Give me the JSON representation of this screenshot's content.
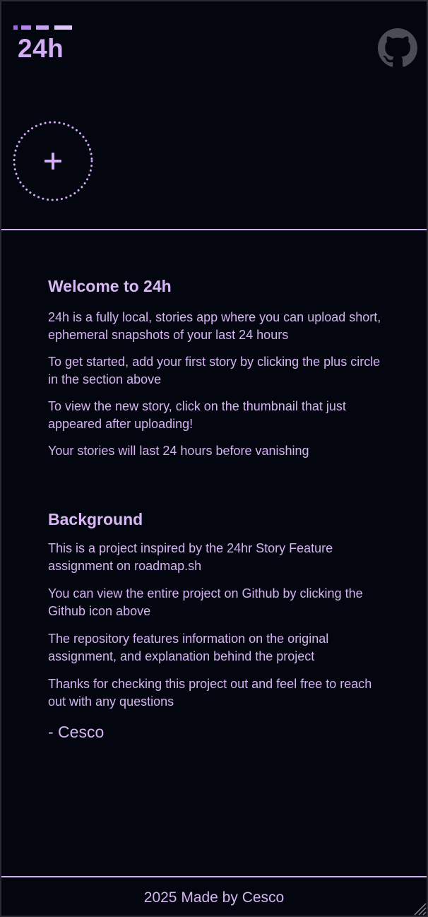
{
  "app": {
    "logo_text": "24h"
  },
  "header": {
    "github_icon": "github-icon",
    "add_story_icon": "plus-icon"
  },
  "welcome": {
    "title": "Welcome to 24h",
    "paragraphs": [
      "24h is a fully local, stories app where you can upload short, ephemeral snapshots of your last 24 hours",
      "To get started, add your first story by clicking the plus circle in the section above",
      "To view the new story, click on the thumbnail that just appeared after uploading!",
      "Your stories will last 24 hours before vanishing"
    ]
  },
  "background": {
    "title": "Background",
    "paragraphs": [
      "This is a project inspired by the 24hr Story Feature assignment on roadmap.sh",
      "You can view the entire project on Github by clicking the Github icon above",
      "The repository features information on the original assignment, and explanation behind the project",
      "Thanks for checking this project out and feel free to reach out with any questions"
    ],
    "signature": "- Cesco"
  },
  "footer": {
    "text": "2025 Made by Cesco"
  },
  "colors": {
    "background": "#03060f",
    "accent": "#d4aef4",
    "accent_dark": "#a064e6",
    "text": "#d6b4f2",
    "icon_gray": "#4a4d55"
  }
}
